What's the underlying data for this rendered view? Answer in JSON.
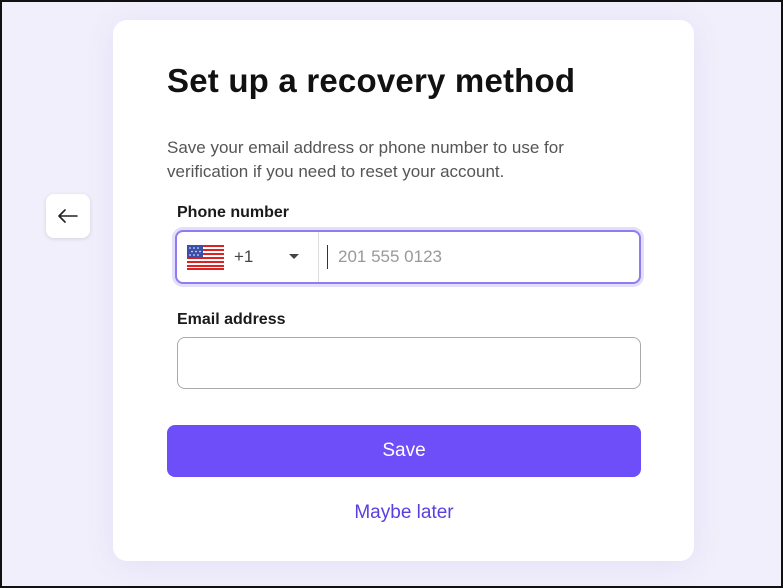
{
  "title": "Set up a recovery method",
  "description": "Save your email address or phone number to use for verification if you need to reset your account.",
  "phone": {
    "label": "Phone number",
    "country_code": "+1",
    "country_icon": "us-flag-icon",
    "placeholder": "201 555 0123",
    "value": ""
  },
  "email": {
    "label": "Email address",
    "value": "",
    "placeholder": ""
  },
  "actions": {
    "save_label": "Save",
    "later_label": "Maybe later"
  },
  "colors": {
    "accent": "#6e4ef8",
    "link": "#5a3fe0",
    "focus_border": "#8f7cf0",
    "background": "#f1effb"
  }
}
